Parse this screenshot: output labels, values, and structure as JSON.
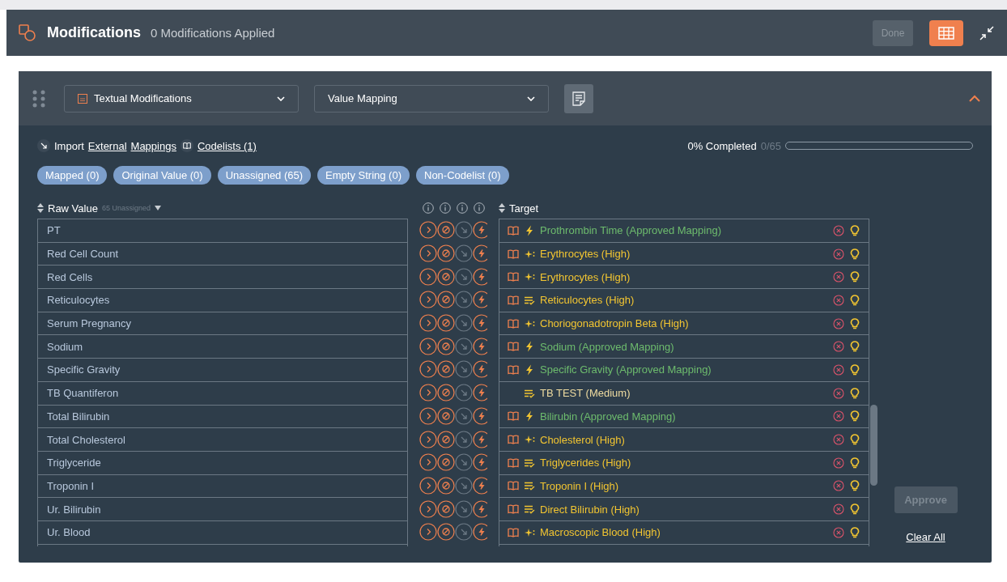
{
  "header": {
    "title": "Modifications",
    "subtitle": "0 Modifications Applied",
    "done_button": {
      "label": "Done",
      "disabled": true
    }
  },
  "toolbar": {
    "modification_type": "Textual Modifications",
    "mapping_type": "Value Mapping"
  },
  "import": {
    "label": "Import",
    "links": [
      "External",
      "Mappings"
    ],
    "codelists": "Codelists (1)"
  },
  "progress": {
    "label": "0% Completed",
    "count": "0/65",
    "level": 0
  },
  "filters": [
    {
      "label": "Mapped (0)"
    },
    {
      "label": "Original Value (0)"
    },
    {
      "label": "Unassigned (65)"
    },
    {
      "label": "Empty String (0)"
    },
    {
      "label": "Non-Codelist (0)"
    }
  ],
  "raw_column": {
    "title": "Raw Value",
    "note": "65 Unassigned"
  },
  "target_column": {
    "title": "Target"
  },
  "action_columns": [
    {
      "kind": "next",
      "disabled": false
    },
    {
      "kind": "empty",
      "disabled": false
    },
    {
      "kind": "arrow",
      "disabled": true
    },
    {
      "kind": "bolt",
      "disabled": false
    }
  ],
  "rows": [
    {
      "raw": "PT",
      "target": "Prothrombin Time (Approved Mapping)",
      "color": "#6dbb6d",
      "kind": "bolt",
      "codelist": true
    },
    {
      "raw": "Red Cell Count",
      "target": "Erythrocytes (High)",
      "color": "#f2c531",
      "kind": "sparkle",
      "codelist": true
    },
    {
      "raw": "Red Cells",
      "target": "Erythrocytes (High)",
      "color": "#f2c531",
      "kind": "sparkle",
      "codelist": true
    },
    {
      "raw": "Reticulocytes",
      "target": "Reticulocytes (High)",
      "color": "#f2c531",
      "kind": "list",
      "codelist": true
    },
    {
      "raw": "Serum Pregnancy",
      "target": "Choriogonadotropin Beta (High)",
      "color": "#f2c531",
      "kind": "sparkle",
      "codelist": true
    },
    {
      "raw": "Sodium",
      "target": "Sodium (Approved Mapping)",
      "color": "#6dbb6d",
      "kind": "bolt",
      "codelist": true
    },
    {
      "raw": "Specific Gravity",
      "target": "Specific Gravity (Approved Mapping)",
      "color": "#6dbb6d",
      "kind": "bolt",
      "codelist": true
    },
    {
      "raw": "TB Quantiferon",
      "target": "TB TEST (Medium)",
      "color": "#eedba0",
      "kind": "list",
      "codelist": false
    },
    {
      "raw": "Total Bilirubin",
      "target": "Bilirubin (Approved Mapping)",
      "color": "#6dbb6d",
      "kind": "bolt",
      "codelist": true
    },
    {
      "raw": "Total Cholesterol",
      "target": "Cholesterol (High)",
      "color": "#f2c531",
      "kind": "sparkle",
      "codelist": true
    },
    {
      "raw": "Triglyceride",
      "target": "Triglycerides (High)",
      "color": "#f2c531",
      "kind": "list",
      "codelist": true
    },
    {
      "raw": "Troponin I",
      "target": "Troponin I (High)",
      "color": "#f2c531",
      "kind": "list",
      "codelist": true
    },
    {
      "raw": "Ur. Bilirubin",
      "target": "Direct Bilirubin (High)",
      "color": "#f2c531",
      "kind": "list",
      "codelist": true
    },
    {
      "raw": "Ur. Blood",
      "target": "Macroscopic Blood (High)",
      "color": "#f2c531",
      "kind": "sparkle",
      "codelist": true
    }
  ],
  "approve_button": {
    "label": "Approve",
    "disabled": true
  },
  "clear_all": "Clear All"
}
